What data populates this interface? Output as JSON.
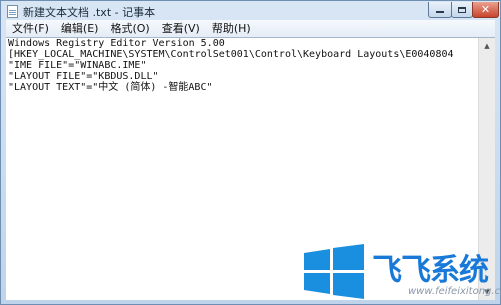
{
  "window": {
    "title": "新建文本文档 .txt - 记事本"
  },
  "menu": [
    {
      "label": "文件(F)"
    },
    {
      "label": "编辑(E)"
    },
    {
      "label": "格式(O)"
    },
    {
      "label": "查看(V)"
    },
    {
      "label": "帮助(H)"
    }
  ],
  "editor": {
    "lines": [
      "Windows Registry Editor Version 5.00",
      "[HKEY_LOCAL_MACHINE\\SYSTEM\\ControlSet001\\Control\\Keyboard Layouts\\E0040804",
      "\"IME FILE\"=\"WINABC.IME\"",
      "\"LAYOUT FILE\"=\"KBDUS.DLL\"",
      "\"LAYOUT TEXT\"=\"中文 (简体) -智能ABC\""
    ]
  },
  "watermark": {
    "brand": "飞飞系统",
    "url": "www.feifeixitong.com",
    "icon": "windows-logo-icon"
  },
  "colors": {
    "brand_blue": "#1879d8",
    "logo_blue": "#1a8fe0",
    "close_red": "#c8442c"
  }
}
